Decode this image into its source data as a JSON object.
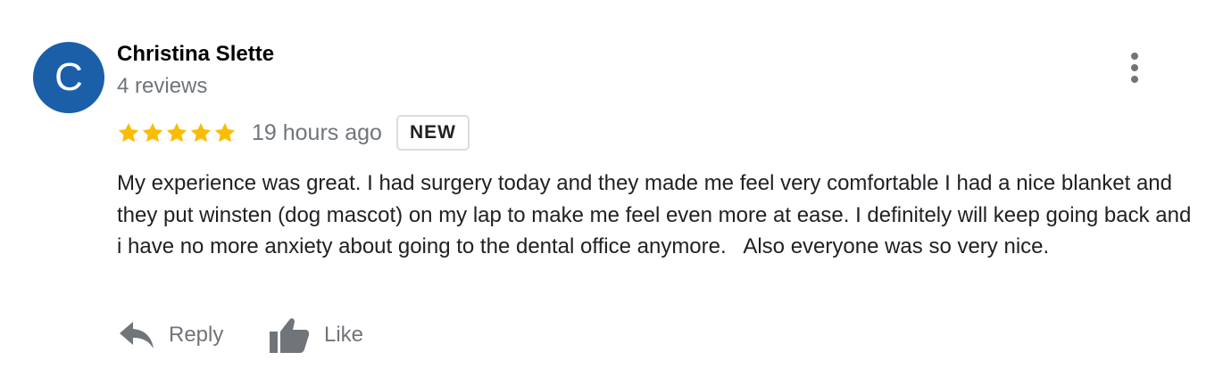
{
  "review": {
    "avatar_letter": "C",
    "avatar_color": "#1a5fa8",
    "reviewer_name": "Christina Slette",
    "review_count": "4 reviews",
    "rating": 5,
    "rating_max": 5,
    "star_color": "#fbbc04",
    "time_ago": "19 hours ago",
    "badge": "NEW",
    "text": "My experience was great. I had surgery today and they made me feel very comfortable I had a nice blanket and they put winsten (dog mascot) on my lap to make me feel even more at ease. I definitely will keep going back and i have no more anxiety about going to the dental office anymore.   Also everyone was so very nice.",
    "menu_icon": "more-vert-icon"
  },
  "actions": {
    "reply_label": "Reply",
    "reply_icon": "reply-arrow-icon",
    "like_label": "Like",
    "like_icon": "thumbs-up-icon"
  }
}
